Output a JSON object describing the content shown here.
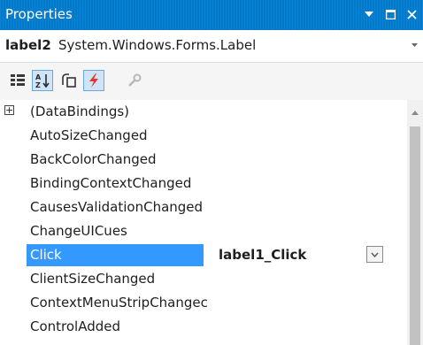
{
  "window": {
    "title": "Properties",
    "pin_icon": "dropdown-pin-icon",
    "restore_icon": "restore-icon",
    "close_icon": "close-icon"
  },
  "object_selector": {
    "name": "label2",
    "type": "System.Windows.Forms.Label"
  },
  "toolbar": {
    "tools": [
      {
        "name": "categorized-icon",
        "active": false
      },
      {
        "name": "alphabetical-icon",
        "active": true
      },
      {
        "name": "properties-icon",
        "active": false
      },
      {
        "name": "events-icon",
        "active": true
      },
      {
        "name": "property-pages-icon",
        "active": false
      }
    ]
  },
  "events": [
    {
      "name": "(DataBindings)",
      "expandable": true,
      "value": ""
    },
    {
      "name": "AutoSizeChanged",
      "value": ""
    },
    {
      "name": "BackColorChanged",
      "value": ""
    },
    {
      "name": "BindingContextChanged",
      "value": ""
    },
    {
      "name": "CausesValidationChanged",
      "value": ""
    },
    {
      "name": "ChangeUICues",
      "value": ""
    },
    {
      "name": "Click",
      "value": "label1_Click",
      "selected": true
    },
    {
      "name": "ClientSizeChanged",
      "value": ""
    },
    {
      "name": "ContextMenuStripChangec",
      "value": ""
    },
    {
      "name": "ControlAdded",
      "value": ""
    }
  ],
  "colors": {
    "titlebar": "#007acc",
    "selection": "#3399ff"
  }
}
